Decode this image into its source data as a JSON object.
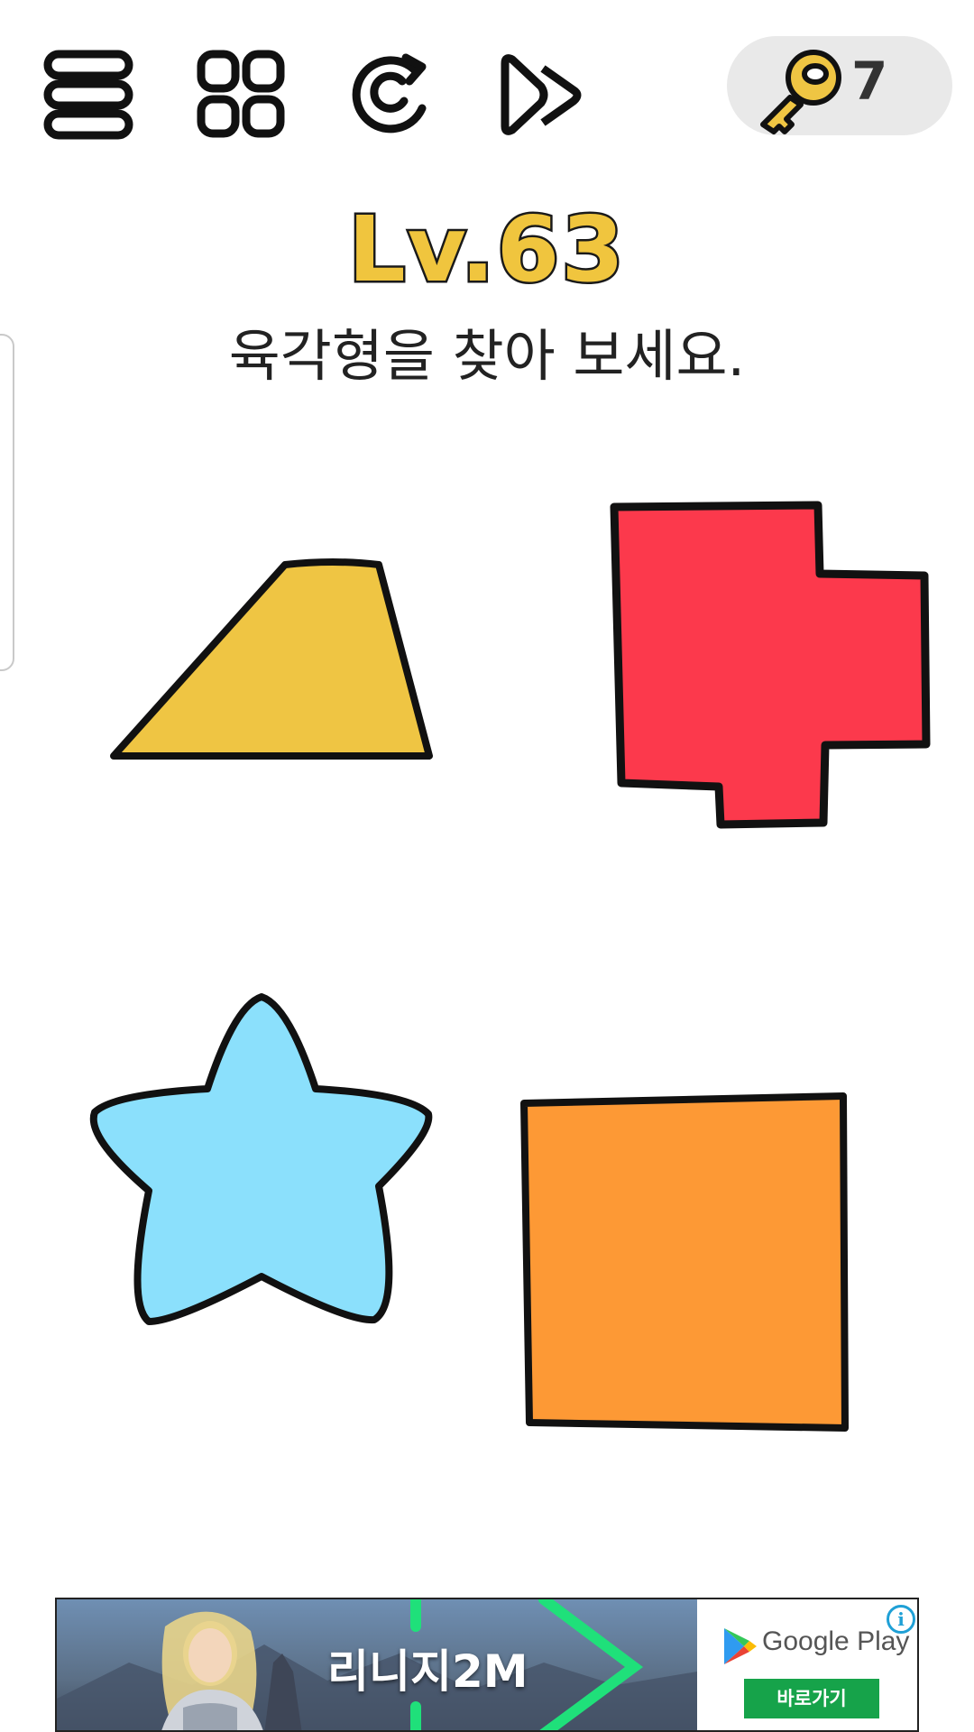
{
  "toolbar": {
    "menu_icon": "menu-lines-icon",
    "levels_icon": "grid-icon",
    "restart_icon": "restart-icon",
    "skip_icon": "fast-forward-icon"
  },
  "hints": {
    "icon": "key-icon",
    "count": "7"
  },
  "level": {
    "title": "Lv.63",
    "question": "육각형을 찾아 보세요."
  },
  "shapes": [
    {
      "name": "trapezoid",
      "color": "#efc543"
    },
    {
      "name": "cross-polygon",
      "color": "#fc394c"
    },
    {
      "name": "star",
      "color": "#8be0fc"
    },
    {
      "name": "square",
      "color": "#fd9935"
    }
  ],
  "ad": {
    "title": "리니지2M",
    "store_label": "Google Play",
    "cta_label": "바로가기",
    "info_icon": "info-icon",
    "info_glyph": "i"
  },
  "colors": {
    "background": "#ffffff",
    "title_fill": "#f0c53e",
    "outline": "#111111",
    "key_pill": "#e9e9e9",
    "cta_green": "#16a34a"
  }
}
